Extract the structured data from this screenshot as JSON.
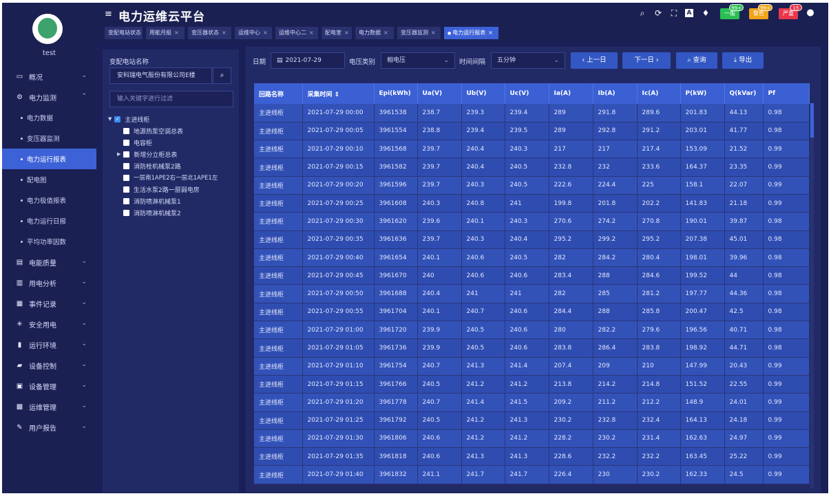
{
  "app": {
    "title": "电力运维云平台",
    "user": "test"
  },
  "header": {
    "icons": [
      "search-icon",
      "refresh-icon",
      "fullscreen-icon",
      "text-icon",
      "shirt-icon"
    ],
    "alarms": [
      {
        "label": "一般",
        "count": "99+",
        "color": "#2bbf53"
      },
      {
        "label": "警告",
        "count": "99+",
        "color": "#f0a418"
      },
      {
        "label": "严重",
        "count": "15",
        "color": "#e8374a"
      }
    ]
  },
  "tabs": [
    {
      "label": "变配电站状态"
    },
    {
      "label": "用能月报"
    },
    {
      "label": "变压器状态"
    },
    {
      "label": "运维中心"
    },
    {
      "label": "运维中心二"
    },
    {
      "label": "配电室"
    },
    {
      "label": "电力数据"
    },
    {
      "label": "变压器监测"
    },
    {
      "label": "电力运行报表"
    }
  ],
  "sidebar": {
    "items": [
      {
        "label": "概况",
        "icon": "monitor-icon"
      },
      {
        "label": "电力监测",
        "icon": "gear-icon"
      },
      {
        "label": "电能质量",
        "icon": "book-icon"
      },
      {
        "label": "用电分析",
        "icon": "bar-chart-icon"
      },
      {
        "label": "事件记录",
        "icon": "list-icon"
      },
      {
        "label": "安全用电",
        "icon": "lightbulb-icon"
      },
      {
        "label": "运行环境",
        "icon": "antenna-icon"
      },
      {
        "label": "设备控制",
        "icon": "control-icon"
      },
      {
        "label": "设备管理",
        "icon": "device-icon"
      },
      {
        "label": "运维管理",
        "icon": "tools-icon"
      },
      {
        "label": "用户报告",
        "icon": "edit-icon"
      }
    ],
    "subitems": [
      {
        "label": "电力数据"
      },
      {
        "label": "变压器监测"
      },
      {
        "label": "电力运行报表"
      },
      {
        "label": "配电图"
      },
      {
        "label": "电力极值报表"
      },
      {
        "label": "电力运行日报"
      },
      {
        "label": "平均功率因数"
      }
    ]
  },
  "left_panel": {
    "label": "变配电站名称",
    "station": "安科瑞电气股份有限公司E楼",
    "filter_placeholder": "输入关键字进行过滤",
    "tree_root": "主进线柜",
    "tree_children": [
      "地源热泵空调总表",
      "电容柜",
      "新增分立柜总表",
      "消防栓机械泵2路",
      "一层南1APE2右一层北1APE1左",
      "生活水泵2路一层弱电房",
      "消防喷淋机械泵1",
      "消防喷淋机械泵2"
    ]
  },
  "filters": {
    "date_label": "日期",
    "date_value": "2021-07-29",
    "voltage_label": "电压类别",
    "voltage_value": "相电压",
    "interval_label": "时间间隔",
    "interval_value": "五分钟",
    "prev_label": "上一日",
    "next_label": "下一日",
    "query_label": "查询",
    "export_label": "导出"
  },
  "table": {
    "headers": [
      "回路名称",
      "采集时间 ⇕",
      "Epi(kWh)",
      "Ua(V)",
      "Ub(V)",
      "Uc(V)",
      "Ia(A)",
      "Ib(A)",
      "Ic(A)",
      "P(kW)",
      "Q(kVar)",
      "Pf"
    ],
    "rows": [
      [
        "主进线柜",
        "2021-07-29 00:00",
        "3961538",
        "238.7",
        "239.3",
        "239.4",
        "289",
        "291.8",
        "289.6",
        "201.83",
        "44.13",
        "0.98"
      ],
      [
        "主进线柜",
        "2021-07-29 00:05",
        "3961554",
        "238.8",
        "239.4",
        "239.5",
        "289",
        "292.8",
        "291.2",
        "203.01",
        "41.77",
        "0.98"
      ],
      [
        "主进线柜",
        "2021-07-29 00:10",
        "3961568",
        "239.7",
        "240.4",
        "240.3",
        "217",
        "217",
        "217.4",
        "153.09",
        "21.52",
        "0.99"
      ],
      [
        "主进线柜",
        "2021-07-29 00:15",
        "3961582",
        "239.7",
        "240.4",
        "240.5",
        "232.8",
        "232",
        "233.6",
        "164.37",
        "23.35",
        "0.99"
      ],
      [
        "主进线柜",
        "2021-07-29 00:20",
        "3961596",
        "239.7",
        "240.3",
        "240.5",
        "222.6",
        "224.4",
        "225",
        "158.1",
        "22.07",
        "0.99"
      ],
      [
        "主进线柜",
        "2021-07-29 00:25",
        "3961608",
        "240.3",
        "240.8",
        "241",
        "199.8",
        "201.8",
        "202.2",
        "141.83",
        "21.18",
        "0.99"
      ],
      [
        "主进线柜",
        "2021-07-29 00:30",
        "3961620",
        "239.6",
        "240.1",
        "240.3",
        "270.6",
        "274.2",
        "270.8",
        "190.01",
        "39.87",
        "0.98"
      ],
      [
        "主进线柜",
        "2021-07-29 00:35",
        "3961636",
        "239.7",
        "240.3",
        "240.4",
        "295.2",
        "299.2",
        "295.2",
        "207.38",
        "45.01",
        "0.98"
      ],
      [
        "主进线柜",
        "2021-07-29 00:40",
        "3961654",
        "240.1",
        "240.6",
        "240.5",
        "282",
        "284.2",
        "280.4",
        "198.01",
        "39.96",
        "0.98"
      ],
      [
        "主进线柜",
        "2021-07-29 00:45",
        "3961670",
        "240",
        "240.6",
        "240.6",
        "283.4",
        "288",
        "284.6",
        "199.52",
        "44",
        "0.98"
      ],
      [
        "主进线柜",
        "2021-07-29 00:50",
        "3961688",
        "240.4",
        "241",
        "241",
        "282",
        "285",
        "281.2",
        "197.77",
        "44.36",
        "0.98"
      ],
      [
        "主进线柜",
        "2021-07-29 00:55",
        "3961704",
        "240.1",
        "240.7",
        "240.6",
        "284.4",
        "288",
        "285.8",
        "200.47",
        "42.5",
        "0.98"
      ],
      [
        "主进线柜",
        "2021-07-29 01:00",
        "3961720",
        "239.9",
        "240.5",
        "240.6",
        "280",
        "282.2",
        "279.6",
        "196.56",
        "40.71",
        "0.98"
      ],
      [
        "主进线柜",
        "2021-07-29 01:05",
        "3961736",
        "239.9",
        "240.5",
        "240.6",
        "283.8",
        "286.4",
        "283.8",
        "198.92",
        "44.71",
        "0.98"
      ],
      [
        "主进线柜",
        "2021-07-29 01:10",
        "3961754",
        "240.7",
        "241.3",
        "241.4",
        "207.4",
        "209",
        "210",
        "147.99",
        "20.43",
        "0.99"
      ],
      [
        "主进线柜",
        "2021-07-29 01:15",
        "3961766",
        "240.5",
        "241.2",
        "241.2",
        "213.8",
        "214.2",
        "214.8",
        "151.52",
        "22.55",
        "0.99"
      ],
      [
        "主进线柜",
        "2021-07-29 01:20",
        "3961778",
        "240.7",
        "241.4",
        "241.5",
        "209.2",
        "211.2",
        "212.2",
        "148.9",
        "24.01",
        "0.99"
      ],
      [
        "主进线柜",
        "2021-07-29 01:25",
        "3961792",
        "240.5",
        "241.2",
        "241.3",
        "230.2",
        "232.8",
        "232.4",
        "164.13",
        "24.18",
        "0.99"
      ],
      [
        "主进线柜",
        "2021-07-29 01:30",
        "3961806",
        "240.6",
        "241.2",
        "241.2",
        "228.2",
        "230.2",
        "231.4",
        "162.63",
        "24.97",
        "0.99"
      ],
      [
        "主进线柜",
        "2021-07-29 01:35",
        "3961818",
        "240.6",
        "241.3",
        "241.3",
        "228.6",
        "232.2",
        "232.2",
        "163.45",
        "25.22",
        "0.99"
      ],
      [
        "主进线柜",
        "2021-07-29 01:40",
        "3961832",
        "241.1",
        "241.7",
        "241.7",
        "226.4",
        "230",
        "230.2",
        "162.33",
        "24.5",
        "0.99"
      ]
    ]
  }
}
